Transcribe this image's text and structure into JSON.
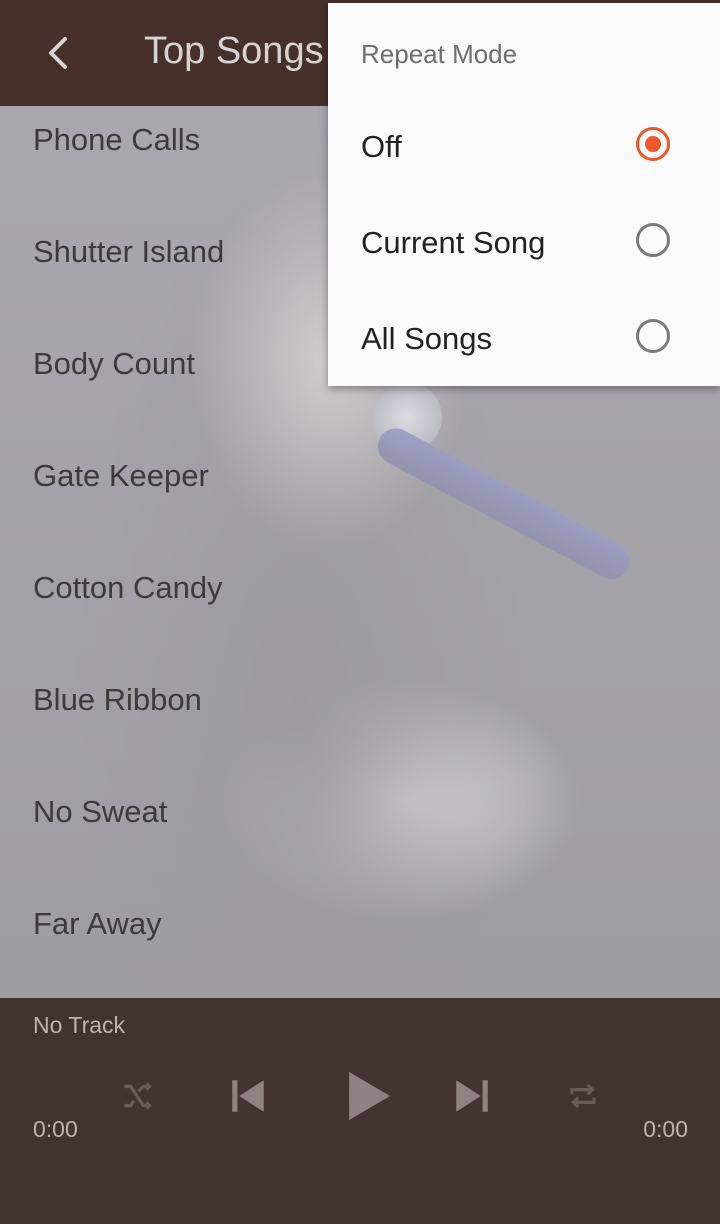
{
  "app_bar": {
    "title": "Top Songs",
    "back_icon": "chevron-left-icon"
  },
  "songs": [
    {
      "title": "Phone Calls"
    },
    {
      "title": "Shutter Island"
    },
    {
      "title": "Body Count"
    },
    {
      "title": "Gate Keeper"
    },
    {
      "title": "Cotton Candy"
    },
    {
      "title": "Blue Ribbon"
    },
    {
      "title": "No Sweat"
    },
    {
      "title": "Far Away"
    }
  ],
  "player": {
    "track_name": "No Track",
    "elapsed": "0:00",
    "duration": "0:00",
    "controls": [
      "shuffle-icon",
      "previous-icon",
      "play-icon",
      "next-icon",
      "repeat-icon"
    ]
  },
  "repeat_menu": {
    "title": "Repeat Mode",
    "options": [
      {
        "label": "Off",
        "selected": true
      },
      {
        "label": "Current Song",
        "selected": false
      },
      {
        "label": "All Songs",
        "selected": false
      }
    ]
  },
  "colors": {
    "app_bar": "#45302c",
    "player": "#423331",
    "accent": "#f0562a"
  }
}
